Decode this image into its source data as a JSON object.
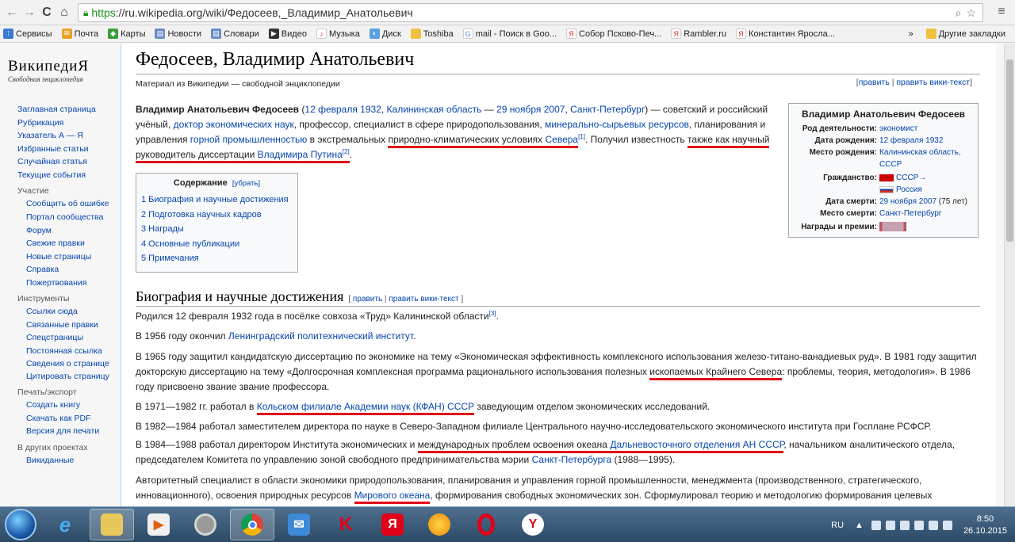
{
  "browser": {
    "url_https": "https",
    "url_rest": "://ru.wikipedia.org/wiki/Федосеев,_Владимир_Анатольевич",
    "bookmarks": [
      "Сервисы",
      "Почта",
      "Карты",
      "Новости",
      "Словари",
      "Видео",
      "Музыка",
      "Диск",
      "Toshiba",
      "mail - Поиск в Goo...",
      "Собор Псково-Печ...",
      "Rambler.ru",
      "Константин Яросла..."
    ],
    "more": "»",
    "other_bookmarks": "Другие закладки"
  },
  "logo": {
    "name": "ВикипедиЯ",
    "tagline": "Свободная энциклопедия"
  },
  "sidebar": {
    "nav": [
      "Заглавная страница",
      "Рубрикация",
      "Указатель А — Я",
      "Избранные статьи",
      "Случайная статья",
      "Текущие события"
    ],
    "participation_title": "Участие",
    "participation": [
      "Сообщить об ошибке",
      "Портал сообщества",
      "Форум",
      "Свежие правки",
      "Новые страницы",
      "Справка",
      "Пожертвования"
    ],
    "tools_title": "Инструменты",
    "tools": [
      "Ссылки сюда",
      "Связанные правки",
      "Спецстраницы",
      "Постоянная ссылка",
      "Сведения о странице",
      "Цитировать страницу"
    ],
    "print_title": "Печать/экспорт",
    "print": [
      "Создать книгу",
      "Скачать как PDF",
      "Версия для печати"
    ],
    "other_title": "В других проектах",
    "other": [
      "Викиданные"
    ]
  },
  "article": {
    "title": "Федосеев, Владимир Анатольевич",
    "tagline": "Материал из Википедии — свободной энциклопедии",
    "edit": "править",
    "sep": "|",
    "edit_wiki": "править вики-текст",
    "lead": {
      "name": "Владимир Анатольевич Федосеев",
      "born_date": "12 февраля 1932",
      "born_place": "Калининская область",
      "dash": "—",
      "died_date": "29 ноября 2007",
      "died_place": "Санкт-Петербург",
      "t1": " — советский и российский учёный, ",
      "degree": "доктор экономических наук",
      "t2": ", профессор, специалист в сфере природопользования, ",
      "resources": "минерально-сырьевых ресурсов",
      "t3": ", планирования и управления ",
      "mining": "горной промышленностью",
      "t4": " в экстремальных ",
      "climate": "природно-климатических условиях",
      "north": "Севера",
      "ref1": "[1]",
      "t5": ". Получил известность ",
      "t6": "также как научный руководитель диссертации",
      "putin": "Владимира Путина",
      "ref2": "[2]",
      "t7": "."
    },
    "toc": {
      "title": "Содержание",
      "toggle": "[убрать]",
      "items": [
        "1 Биография и научные достижения",
        "2 Подготовка научных кадров",
        "3 Награды",
        "4 Основные публикации",
        "5 Примечания"
      ]
    },
    "infobox": {
      "title": "Владимир Анатольевич Федосеев",
      "rows": [
        {
          "k": "Род деятельности:",
          "v": "экономист"
        },
        {
          "k": "Дата рождения:",
          "v": "12 февраля 1932"
        },
        {
          "k": "Место рождения:",
          "v": "Калининская область, СССР"
        },
        {
          "k": "Гражданство:",
          "v": "СССР→"
        },
        {
          "k": "",
          "v": "Россия"
        },
        {
          "k": "Дата смерти:",
          "v": "29 ноября 2007",
          "extra": " (75 лет)"
        },
        {
          "k": "Место смерти:",
          "v": "Санкт-Петербург"
        },
        {
          "k": "Награды и премии:",
          "v": ""
        }
      ]
    },
    "section": {
      "title": "Биография и научные достижения",
      "edit_open": "[ ",
      "edit": "править",
      "sep": " | ",
      "edit_wiki": "править вики-текст",
      "edit_close": " ]"
    },
    "p1": {
      "text": "Родился 12 февраля 1932 года в посёлке совхоза «Труд» Калининской области",
      "ref": "[3]",
      "end": "."
    },
    "p2": {
      "text": "В 1956 году окончил ",
      "link": "Ленинградский политехнический институт",
      "end": "."
    },
    "p3": {
      "a": "В 1965 году защитил кандидатскую диссертацию по экономике на тему «Экономическая эффективность комплексного использования железо-титано-ванадиевых руд». В 1981 году защитил докторскую диссертацию на тему «Долгосрочная комплексная программа рационального использования полезных ",
      "b": "ископаемых Крайнего Севера",
      "c": ": проблемы, теория, методология». В 1986 году присвоено звание звание профессора."
    },
    "p4": {
      "a": "В 1971—1982 гг. работал в ",
      "link": "Кольском филиале Академии наук (КФАН) СССР",
      "c": " заведующим отделом экономических исследований."
    },
    "p5": {
      "text": "В 1982—1984 работал заместителем директора по науке в Северо-Западном филиале Центрального научно-исследовательского экономического института при Госплане РСФСР."
    },
    "p6": {
      "a": "В 1984—1988 работал директором Института экономических и ",
      "b": "международных проблем освоения океана ",
      "link": "Дальневосточного отделения АН СССР",
      "c": ", начальником аналитического отдела, председателем Комитета по управлению зоной свободного предпринимательства мэрии ",
      "city": "Санкт-Петербурга",
      "d": " (1988—1995)."
    },
    "p7": {
      "a": "Авторитетный специалист в области экономики природопользования, планирования и управления горной промышленности, менеджмента (производственного, стратегического, инновационного), освоения природных ресурсов ",
      "link": "Мирового океана",
      "c": ", формирования свободных экономических зон. Сформулировал теорию и методологию формирования целевых комплексных инвестиционных программ освоения минерально-сырьевых ресурсов с использованием..."
    }
  },
  "taskbar": {
    "lang": "RU",
    "time": "8:50",
    "date": "26.10.2015"
  }
}
